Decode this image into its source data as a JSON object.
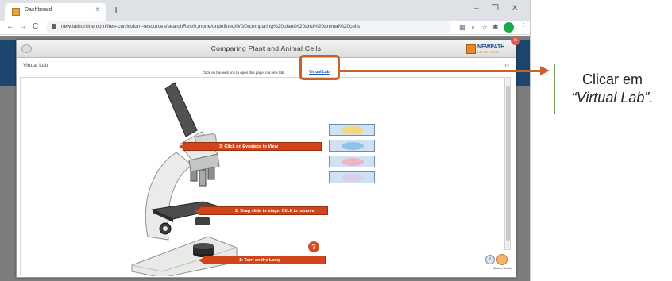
{
  "browser": {
    "tab_title": "Dashboard",
    "tab_close": "×",
    "new_tab": "+",
    "minimize": "–",
    "restore": "❐",
    "close": "✕",
    "back": "←",
    "forward": "→",
    "reload": "C",
    "url": "newpathonline.com/free-curriculum-resources/searchRes/0,/none/undefined/0/0/0/comparing%20plant%20and%20animal%20cells",
    "menu": "⋮"
  },
  "modal": {
    "title": "Comparing Plant and Animal Cells",
    "logo_top": "NEWPATH",
    "logo_bottom": "LEARNING",
    "close_glyph": "×"
  },
  "virtual_lab": {
    "header_label": "Virtual Lab",
    "instruction": "Click on the web link to open this page in a new tab",
    "link_text": "Virtual Lab",
    "callouts": {
      "eyepiece": "3: Click on Eyepiece to View",
      "stage": "2: Drag slide to stage. Click to remove.",
      "lamp": "1: Turn on the Lamp"
    },
    "help_glyph": "?",
    "info_glyph": "i",
    "avatar_label": "Student Activity"
  },
  "annotation": {
    "line1": "Clicar em",
    "line2": "“Virtual Lab”."
  },
  "colors": {
    "accent": "#c8622a",
    "callout": "#d24419",
    "header_blue": "#1c466e"
  }
}
